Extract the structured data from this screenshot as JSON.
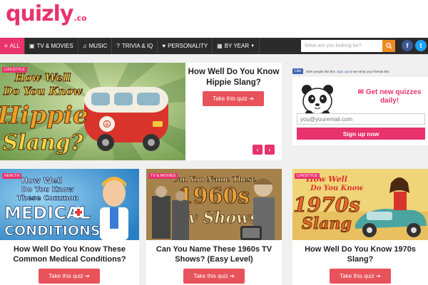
{
  "header": {
    "logo_main": "quizly",
    "logo_tld": ".co"
  },
  "nav": {
    "items": [
      {
        "icon": "≡",
        "label": "ALL"
      },
      {
        "icon": "▣",
        "label": "TV & MOVIES"
      },
      {
        "icon": "♫",
        "label": "MUSIC"
      },
      {
        "icon": "?",
        "label": "TRIVIA & IQ"
      },
      {
        "icon": "♥",
        "label": "PERSONALITY"
      },
      {
        "icon": "▦",
        "label": "BY YEAR"
      }
    ],
    "search_placeholder": "What are you looking for?",
    "social": {
      "facebook": "f",
      "twitter": "t"
    }
  },
  "hero": {
    "badge": "LIFESTYLE",
    "art_lines": [
      "How Well",
      "Do You Know",
      "Hippie",
      "Slang?"
    ],
    "title": "How Well Do You Know Hippie Slang?",
    "button": "Take this quiz ➔",
    "prev": "‹",
    "next": "›"
  },
  "signup": {
    "like_button": "Like",
    "like_count": "192K people like this.",
    "like_signup": "Sign Up",
    "like_rest": "to see what your friends like.",
    "heading": "Get new quizzes daily!",
    "email_placeholder": "you@youremail.com",
    "button": "Sign up now"
  },
  "cards": [
    {
      "badge": "HEALTH",
      "art_lines": [
        "How Well",
        "Do You Know",
        "These Common",
        "MEDICAL",
        "CONDITIONS?"
      ],
      "title": "How Well Do You Know These Common Medical Conditions?",
      "button": "Take this quiz ➔"
    },
    {
      "badge": "TV & MOVIES",
      "art_lines": [
        "Can You Name These",
        "1960s",
        "Tv Shows"
      ],
      "title": "Can You Name These 1960s TV Shows? (Easy Level)",
      "button": "Take this quiz ➔"
    },
    {
      "badge": "LIFESTYLE",
      "art_lines": [
        "How Well",
        "Do You Know",
        "1970s",
        "Slang"
      ],
      "title": "How Well Do You Know 1970s Slang?",
      "button": "Take this quiz ➔"
    }
  ],
  "colors": {
    "brand": "#e8336d",
    "button": "#e8525a",
    "nav": "#2b2b2b",
    "search_button": "#f08a24",
    "facebook": "#3b5998",
    "twitter": "#1da1f2"
  }
}
